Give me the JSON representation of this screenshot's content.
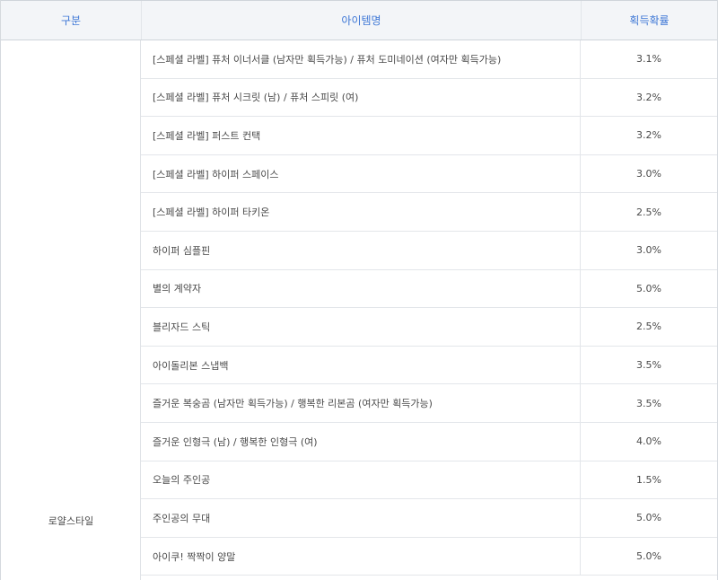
{
  "header": {
    "category": "구분",
    "item_name": "아이템명",
    "rate": "획득확률"
  },
  "category": "로얄스타일",
  "rows": [
    {
      "name": "[스페셜 라벨] 퓨처 이너서클 (남자만 획득가능) / 퓨처 도미네이션 (여자만 획득가능)",
      "rate": "3.1%"
    },
    {
      "name": "[스페셜 라벨] 퓨처 시크릿 (남) / 퓨처 스피릿 (여)",
      "rate": "3.2%"
    },
    {
      "name": "[스페셜 라벨] 퍼스트 컨택",
      "rate": "3.2%"
    },
    {
      "name": "[스페셜 라벨] 하이퍼 스페이스",
      "rate": "3.0%"
    },
    {
      "name": "[스페셜 라벨] 하이퍼 타키온",
      "rate": "2.5%"
    },
    {
      "name": "하이퍼 심플핀",
      "rate": "3.0%"
    },
    {
      "name": "별의 계약자",
      "rate": "5.0%"
    },
    {
      "name": "블리자드 스틱",
      "rate": "2.5%"
    },
    {
      "name": "아이돌리본 스냅백",
      "rate": "3.5%"
    },
    {
      "name": "즐거운 복숭곰 (남자만 획득가능) / 행복한 리본곰 (여자만 획득가능)",
      "rate": "3.5%"
    },
    {
      "name": "즐거운 인형극 (남) / 행복한 인형극 (여)",
      "rate": "4.0%"
    },
    {
      "name": "오늘의 주인공",
      "rate": "1.5%"
    },
    {
      "name": "주인공의 무대",
      "rate": "5.0%"
    },
    {
      "name": "아이쿠! 짝짝이 양말",
      "rate": "5.0%"
    }
  ]
}
